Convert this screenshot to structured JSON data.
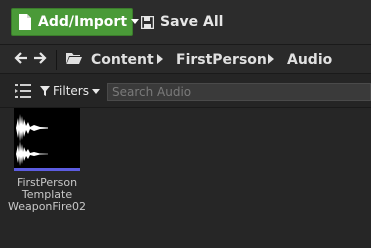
{
  "toolbar": {
    "add_import_label": "Add/Import",
    "save_all_label": "Save All"
  },
  "path": {
    "crumbs": [
      "Content",
      "FirstPerson",
      "Audio"
    ]
  },
  "filterbar": {
    "filters_label": "Filters",
    "search_placeholder": "Search Audio"
  },
  "assets": [
    {
      "name_lines": [
        "FirstPerson",
        "Template",
        "WeaponFire02"
      ],
      "icon": "sound-wave-icon"
    }
  ],
  "colors": {
    "accent_green": "#4a9a38",
    "asset_type_bar": "#5c5ce0",
    "background": "#262626"
  }
}
